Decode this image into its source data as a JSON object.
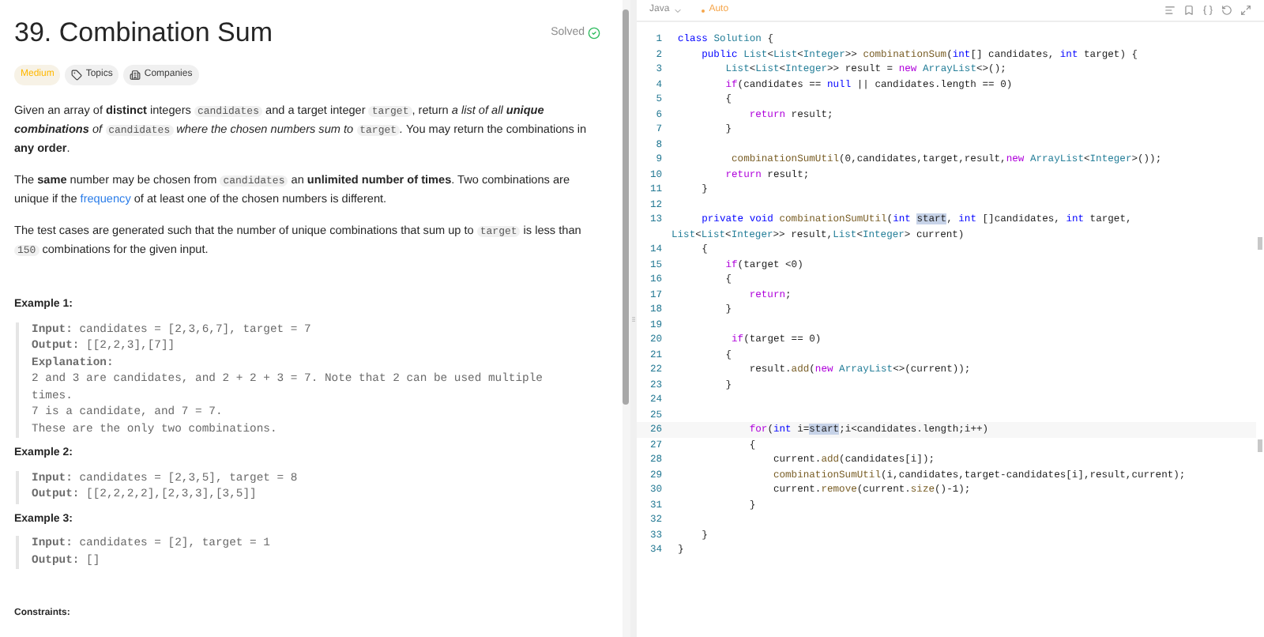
{
  "problem": {
    "title": "39. Combination Sum",
    "status": "Solved",
    "solved": true,
    "tags": [
      {
        "kind": "difficulty",
        "label": "Medium"
      },
      {
        "kind": "topics",
        "label": "Topics"
      },
      {
        "kind": "companies",
        "label": "Companies"
      }
    ],
    "paragraphs": [
      [
        {
          "kind": "text",
          "text": "Given an array of **distinct** integers "
        },
        {
          "kind": "code",
          "text": "candidates"
        },
        {
          "kind": "text",
          "text": " and a target integer "
        },
        {
          "kind": "code",
          "text": "target"
        },
        {
          "kind": "text",
          "text": ", return *a list of all* "
        },
        {
          "kind": "bolditalic",
          "text": "unique combinations"
        },
        {
          "kind": "text",
          "text": " *of* "
        },
        {
          "kind": "code",
          "text": "candidates"
        },
        {
          "kind": "text",
          "text": " *where the chosen numbers sum to* "
        },
        {
          "kind": "code",
          "text": "target"
        },
        {
          "kind": "text",
          "text": "*.* You may return the combinations in **any order**."
        }
      ],
      [
        {
          "kind": "text",
          "text": "The **same** number may be chosen from "
        },
        {
          "kind": "code",
          "text": "candidates"
        },
        {
          "kind": "text",
          "text": " an **unlimited number of times**. Two combinations are unique if the "
        },
        {
          "kind": "link",
          "text": "frequency"
        },
        {
          "kind": "text",
          "text": " of at least one of the chosen numbers is different."
        }
      ],
      [
        {
          "kind": "text",
          "text": "The test cases are generated such that the number of unique combinations that sum up to "
        },
        {
          "kind": "code",
          "text": "target"
        },
        {
          "kind": "text",
          "text": " is less than "
        },
        {
          "kind": "code",
          "text": "150"
        },
        {
          "kind": "text",
          "text": " combinations for the given input."
        }
      ]
    ],
    "examples": [
      {
        "title": "Example 1:",
        "lines": [
          "**Input:** candidates = [2,3,6,7], target = 7",
          "**Output:** [[2,2,3],[7]]",
          "**Explanation:**",
          "2 and 3 are candidates, and 2 + 2 + 3 = 7. Note that 2 can be used multiple times.",
          "7 is a candidate, and 7 = 7.",
          "These are the only two combinations."
        ]
      },
      {
        "title": "Example 2:",
        "lines": [
          "**Input:** candidates = [2,3,5], target = 8",
          "**Output:** [[2,2,2,2],[2,3,3],[3,5]]"
        ]
      },
      {
        "title": "Example 3:",
        "lines": [
          "**Input:** candidates = [2], target = 1",
          "**Output:** []"
        ]
      }
    ],
    "constraints_title": "Constraints:"
  },
  "editor": {
    "language": "Java",
    "autosave": "Auto",
    "lines": [
      {
        "num": "1",
        "segs": [
          {
            "kind": "decl",
            "text": "class "
          },
          {
            "kind": "type",
            "text": "Solution"
          },
          {
            "kind": "plain",
            "text": " {"
          }
        ]
      },
      {
        "num": "2",
        "segs": [
          {
            "kind": "decl",
            "text": "    public "
          },
          {
            "kind": "type",
            "text": "List"
          },
          {
            "kind": "plain",
            "text": "<"
          },
          {
            "kind": "type",
            "text": "List"
          },
          {
            "kind": "plain",
            "text": "<"
          },
          {
            "kind": "type",
            "text": "Integer"
          },
          {
            "kind": "plain",
            "text": ">> "
          },
          {
            "kind": "fn",
            "text": "combinationSum"
          },
          {
            "kind": "plain",
            "text": "("
          },
          {
            "kind": "decl",
            "text": "int"
          },
          {
            "kind": "plain",
            "text": "[] candidates, "
          },
          {
            "kind": "decl",
            "text": "int"
          },
          {
            "kind": "plain",
            "text": " target) {"
          }
        ]
      },
      {
        "num": "3",
        "segs": [
          {
            "kind": "type",
            "text": "        List"
          },
          {
            "kind": "plain",
            "text": "<"
          },
          {
            "kind": "type",
            "text": "List"
          },
          {
            "kind": "plain",
            "text": "<"
          },
          {
            "kind": "type",
            "text": "Integer"
          },
          {
            "kind": "plain",
            "text": ">> result = "
          },
          {
            "kind": "kw",
            "text": "new "
          },
          {
            "kind": "type",
            "text": "ArrayList"
          },
          {
            "kind": "plain",
            "text": "<>();"
          }
        ]
      },
      {
        "num": "4",
        "segs": [
          {
            "kind": "kw",
            "text": "        if"
          },
          {
            "kind": "plain",
            "text": "(candidates == "
          },
          {
            "kind": "decl",
            "text": "null"
          },
          {
            "kind": "plain",
            "text": " || candidates.length == 0)"
          }
        ]
      },
      {
        "num": "5",
        "segs": [
          {
            "kind": "plain",
            "text": "        {"
          }
        ]
      },
      {
        "num": "6",
        "segs": [
          {
            "kind": "kw",
            "text": "            return"
          },
          {
            "kind": "plain",
            "text": " result;"
          }
        ]
      },
      {
        "num": "7",
        "segs": [
          {
            "kind": "plain",
            "text": "        }"
          }
        ]
      },
      {
        "num": "8"
      },
      {
        "num": "9",
        "segs": [
          {
            "kind": "fn",
            "text": "         combinationSumUtil"
          },
          {
            "kind": "plain",
            "text": "(0,candidates,target,result,"
          },
          {
            "kind": "kw",
            "text": "new "
          },
          {
            "kind": "type",
            "text": "ArrayList"
          },
          {
            "kind": "plain",
            "text": "<"
          },
          {
            "kind": "type",
            "text": "Integer"
          },
          {
            "kind": "plain",
            "text": ">());"
          }
        ]
      },
      {
        "num": "10",
        "segs": [
          {
            "kind": "kw",
            "text": "        return"
          },
          {
            "kind": "plain",
            "text": " result;"
          }
        ]
      },
      {
        "num": "11",
        "segs": [
          {
            "kind": "plain",
            "text": "    }"
          }
        ]
      },
      {
        "num": "12"
      },
      {
        "num": "13",
        "segs": [
          {
            "kind": "decl",
            "text": "    private void "
          },
          {
            "kind": "fn",
            "text": "combinationSumUtil"
          },
          {
            "kind": "plain",
            "text": "("
          },
          {
            "kind": "decl",
            "text": "int "
          },
          {
            "kind": "match",
            "text": "start"
          },
          {
            "kind": "plain",
            "text": ", "
          },
          {
            "kind": "decl",
            "text": "int"
          },
          {
            "kind": "plain",
            "text": " []candidates, "
          },
          {
            "kind": "decl",
            "text": "int"
          },
          {
            "kind": "plain",
            "text": " target,"
          }
        ],
        "cont": [
          {
            "kind": "type",
            "text": "List"
          },
          {
            "kind": "plain",
            "text": "<"
          },
          {
            "kind": "type",
            "text": "List"
          },
          {
            "kind": "plain",
            "text": "<"
          },
          {
            "kind": "type",
            "text": "Integer"
          },
          {
            "kind": "plain",
            "text": ">> result,"
          },
          {
            "kind": "type",
            "text": "List"
          },
          {
            "kind": "plain",
            "text": "<"
          },
          {
            "kind": "type",
            "text": "Integer"
          },
          {
            "kind": "plain",
            "text": "> current)"
          }
        ]
      },
      {
        "num": "14",
        "segs": [
          {
            "kind": "plain",
            "text": "    {"
          }
        ]
      },
      {
        "num": "15",
        "segs": [
          {
            "kind": "kw",
            "text": "        if"
          },
          {
            "kind": "plain",
            "text": "(target <0)"
          }
        ]
      },
      {
        "num": "16",
        "segs": [
          {
            "kind": "plain",
            "text": "        {"
          }
        ]
      },
      {
        "num": "17",
        "segs": [
          {
            "kind": "kw",
            "text": "            return"
          },
          {
            "kind": "plain",
            "text": ";"
          }
        ]
      },
      {
        "num": "18",
        "segs": [
          {
            "kind": "plain",
            "text": "        }"
          }
        ]
      },
      {
        "num": "19"
      },
      {
        "num": "20",
        "segs": [
          {
            "kind": "kw",
            "text": "         if"
          },
          {
            "kind": "plain",
            "text": "(target == 0)"
          }
        ]
      },
      {
        "num": "21",
        "segs": [
          {
            "kind": "plain",
            "text": "        {"
          }
        ]
      },
      {
        "num": "22",
        "segs": [
          {
            "kind": "plain",
            "text": "            result."
          },
          {
            "kind": "fn",
            "text": "add"
          },
          {
            "kind": "plain",
            "text": "("
          },
          {
            "kind": "kw",
            "text": "new "
          },
          {
            "kind": "type",
            "text": "ArrayList"
          },
          {
            "kind": "plain",
            "text": "<>(current));"
          }
        ]
      },
      {
        "num": "23",
        "segs": [
          {
            "kind": "plain",
            "text": "        }"
          }
        ]
      },
      {
        "num": "24"
      },
      {
        "num": "25"
      },
      {
        "num": "26",
        "current": true,
        "segs": [
          {
            "kind": "kw",
            "text": "            for"
          },
          {
            "kind": "plain",
            "text": "("
          },
          {
            "kind": "decl",
            "text": "int"
          },
          {
            "kind": "plain",
            "text": " i="
          },
          {
            "kind": "match",
            "text": "start"
          },
          {
            "kind": "plain",
            "text": ";i<candidates.length;i++)"
          }
        ]
      },
      {
        "num": "27",
        "segs": [
          {
            "kind": "plain",
            "text": "            {"
          }
        ]
      },
      {
        "num": "28",
        "segs": [
          {
            "kind": "plain",
            "text": "                current."
          },
          {
            "kind": "fn",
            "text": "add"
          },
          {
            "kind": "plain",
            "text": "(candidates[i]);"
          }
        ]
      },
      {
        "num": "29",
        "segs": [
          {
            "kind": "fn",
            "text": "                combinationSumUtil"
          },
          {
            "kind": "plain",
            "text": "(i,candidates,target-candidates[i],result,current);"
          }
        ]
      },
      {
        "num": "30",
        "segs": [
          {
            "kind": "plain",
            "text": "                current."
          },
          {
            "kind": "fn",
            "text": "remove"
          },
          {
            "kind": "plain",
            "text": "(current."
          },
          {
            "kind": "fn",
            "text": "size"
          },
          {
            "kind": "plain",
            "text": "()-1);"
          }
        ]
      },
      {
        "num": "31",
        "segs": [
          {
            "kind": "plain",
            "text": "            }"
          }
        ]
      },
      {
        "num": "32"
      },
      {
        "num": "33",
        "segs": [
          {
            "kind": "plain",
            "text": "    }"
          }
        ]
      },
      {
        "num": "34",
        "segs": [
          {
            "kind": "plain",
            "text": "}"
          }
        ]
      }
    ]
  }
}
